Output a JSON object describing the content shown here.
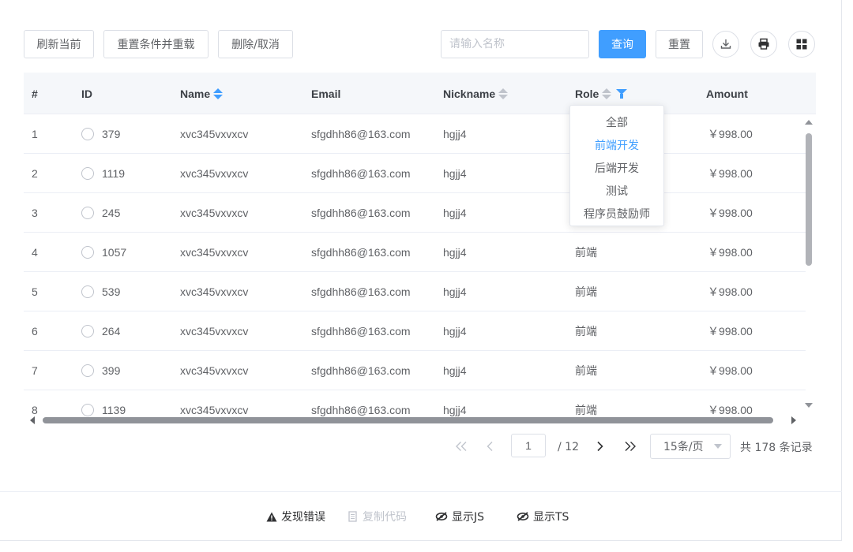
{
  "toolbar": {
    "refresh_label": "刷新当前",
    "reset_reload_label": "重置条件并重载",
    "delete_cancel_label": "删除/取消",
    "search_placeholder": "请输入名称",
    "search_value": "",
    "query_label": "查询",
    "reset_label": "重置",
    "icons": [
      "download-icon",
      "print-icon",
      "grid-icon"
    ]
  },
  "table": {
    "columns": [
      "#",
      "ID",
      "Name",
      "Email",
      "Nickname",
      "Role",
      "Amount"
    ],
    "sorted_column": "Name",
    "rows": [
      {
        "index": "1",
        "id": "379",
        "name": "xvc345vxvxcv",
        "email": "sfgdhh86@163.com",
        "nickname": "hgjj4",
        "role": "",
        "amount": "￥998.00"
      },
      {
        "index": "2",
        "id": "1119",
        "name": "xvc345vxvxcv",
        "email": "sfgdhh86@163.com",
        "nickname": "hgjj4",
        "role": "",
        "amount": "￥998.00"
      },
      {
        "index": "3",
        "id": "245",
        "name": "xvc345vxvxcv",
        "email": "sfgdhh86@163.com",
        "nickname": "hgjj4",
        "role": "",
        "amount": "￥998.00"
      },
      {
        "index": "4",
        "id": "1057",
        "name": "xvc345vxvxcv",
        "email": "sfgdhh86@163.com",
        "nickname": "hgjj4",
        "role": "前端",
        "amount": "￥998.00"
      },
      {
        "index": "5",
        "id": "539",
        "name": "xvc345vxvxcv",
        "email": "sfgdhh86@163.com",
        "nickname": "hgjj4",
        "role": "前端",
        "amount": "￥998.00"
      },
      {
        "index": "6",
        "id": "264",
        "name": "xvc345vxvxcv",
        "email": "sfgdhh86@163.com",
        "nickname": "hgjj4",
        "role": "前端",
        "amount": "￥998.00"
      },
      {
        "index": "7",
        "id": "399",
        "name": "xvc345vxvxcv",
        "email": "sfgdhh86@163.com",
        "nickname": "hgjj4",
        "role": "前端",
        "amount": "￥998.00"
      },
      {
        "index": "8",
        "id": "1139",
        "name": "xvc345vxvxcv",
        "email": "sfgdhh86@163.com",
        "nickname": "hgjj4",
        "role": "前端",
        "amount": "￥998.00"
      }
    ]
  },
  "role_filter": {
    "options": [
      "全部",
      "前端开发",
      "后端开发",
      "测试",
      "程序员鼓励师"
    ],
    "selected": "前端开发"
  },
  "pager": {
    "current_page": "1",
    "total_pages": "/ 12",
    "page_size": "15条/页",
    "total_text": "共 178 条记录"
  },
  "footer": {
    "report_error": "发现错误",
    "copy_code": "复制代码",
    "show_js": "显示JS",
    "show_ts": "显示TS"
  },
  "colors": {
    "primary": "#409eff",
    "header_bg": "#f5f7fa",
    "border": "#dcdfe6"
  }
}
